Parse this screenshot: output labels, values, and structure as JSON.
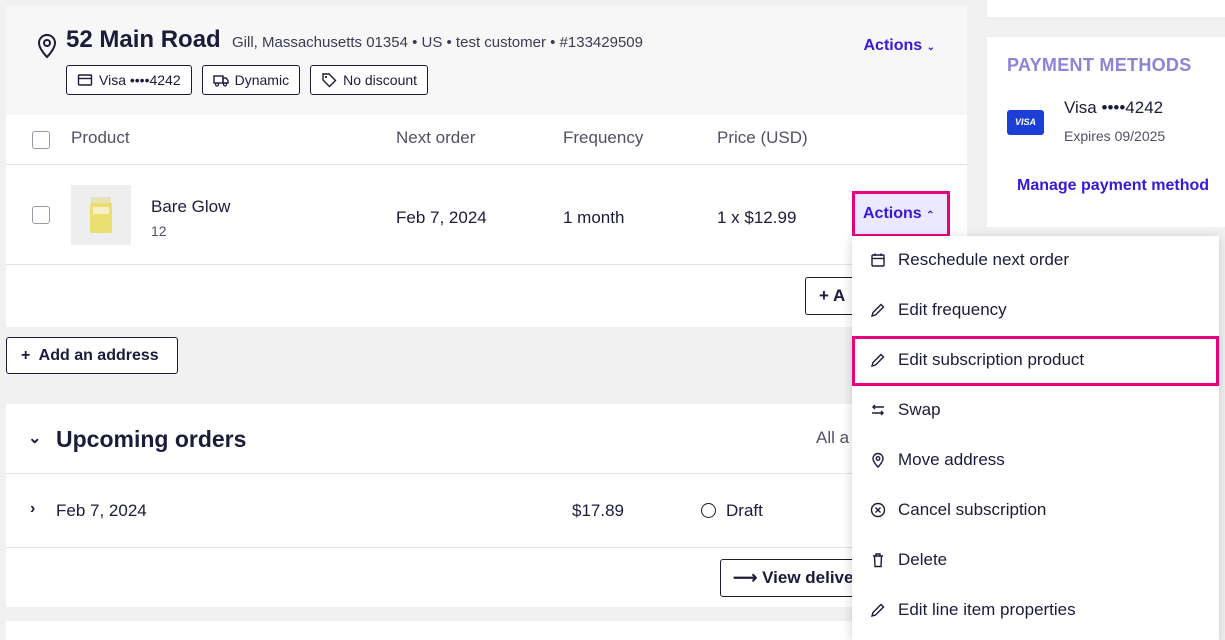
{
  "address": {
    "title": "52 Main Road",
    "meta": "Gill, Massachusetts 01354  •  US  •  test customer  •  #133429509",
    "actions_label": "Actions",
    "chips": {
      "card": "Visa ••••4242",
      "shipping": "Dynamic",
      "discount": "No discount"
    }
  },
  "table": {
    "headers": {
      "product": "Product",
      "next_order": "Next order",
      "frequency": "Frequency",
      "price": "Price (USD)"
    },
    "row": {
      "name": "Bare Glow",
      "qty": "12",
      "next_order": "Feb 7, 2024",
      "frequency": "1 month",
      "price": "1 x $12.99",
      "actions_label": "Actions"
    },
    "add_product_label": "A"
  },
  "add_address_label": "Add an address",
  "upcoming": {
    "title": "Upcoming orders",
    "filter": "All a",
    "order": {
      "date": "Feb 7, 2024",
      "amount": "$17.89",
      "status": "Draft"
    },
    "view_label": "View delive"
  },
  "payment": {
    "title": "PAYMENT METHODS",
    "badge": "VISA",
    "card": "Visa ••••4242",
    "expires": "Expires 09/2025",
    "manage": "Manage payment method"
  },
  "menu": [
    {
      "label": "Reschedule next order",
      "icon": "calendar-icon"
    },
    {
      "label": "Edit frequency",
      "icon": "pencil-icon"
    },
    {
      "label": "Edit subscription product",
      "icon": "pencil-icon"
    },
    {
      "label": "Swap",
      "icon": "swap-icon"
    },
    {
      "label": "Move address",
      "icon": "location-pin-icon"
    },
    {
      "label": "Cancel subscription",
      "icon": "cancel-circle-icon"
    },
    {
      "label": "Delete",
      "icon": "trash-icon"
    },
    {
      "label": "Edit line item properties",
      "icon": "pencil-icon"
    }
  ],
  "colors": {
    "accent": "#3a17d9",
    "highlight": "#e6037e",
    "text": "#1b1b3a",
    "visa": "#1a3ed6"
  }
}
